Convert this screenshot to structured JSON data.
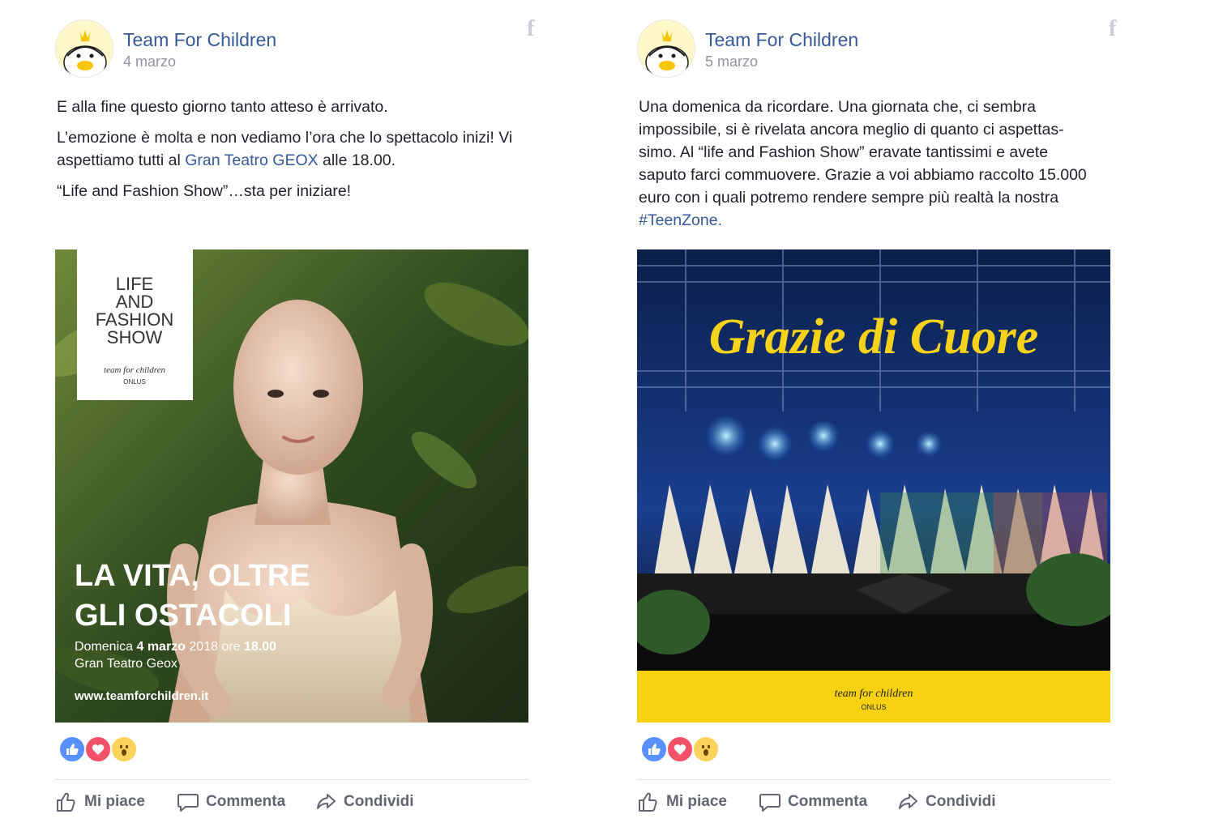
{
  "posts": [
    {
      "author": "Team For Children",
      "date": "4 marzo",
      "paragraphs": [
        "E alla fine questo giorno tanto atteso è arrivato.",
        "L’emozione è molta e non vediamo l’ora che lo spettacolo inizi! Vi aspettiamo tutti al ",
        "“Life and Fashion Show”…sta per iniziare!"
      ],
      "link_text": "Gran Teatro GEOX",
      "link_after": " alle 18.00.",
      "image": {
        "badge_lines": [
          "LIFE",
          "AND",
          "FASHION",
          "SHOW"
        ],
        "badge_logo": "team for children",
        "badge_logo_sub": "ONLUS",
        "headline_1": "LA VITA, OLTRE",
        "headline_2": "GLI OSTACOLI",
        "event_prefix": "Domenica ",
        "event_bold": "4 marzo",
        "event_mid": " 2018 ore ",
        "event_time": "18.00",
        "venue": "Gran Teatro Geox",
        "website": "www.teamforchildren.it"
      },
      "actions": {
        "like": "Mi piace",
        "comment": "Commenta",
        "share": "Condividi"
      }
    },
    {
      "author": "Team For Children",
      "date": "5 marzo",
      "body": "Una domenica da ricordare. Una giornata che, ci sembra impossibile, si è rivelata ancora meglio di quanto ci aspettas-simo. Al “life and Fashion Show” eravate tantissimi e avete saputo farci commuovere. Grazie a voi abbiamo raccolto 15.000 euro con i quali potremo rendere sempre più realtà la nostra ",
      "hashtag": "#TeenZone.",
      "image": {
        "headline": "Grazie di Cuore",
        "logo": "team for children",
        "logo_sub": "ONLUS"
      },
      "actions": {
        "like": "Mi piace",
        "comment": "Commenta",
        "share": "Condividi"
      }
    }
  ],
  "colors": {
    "link": "#365899",
    "meta": "#90949c",
    "action": "#606770",
    "like": "#5890ff",
    "love": "#f25268",
    "wow": "#fcd35a",
    "banner_yellow": "#f8d210"
  },
  "icons": [
    "facebook-icon",
    "like-icon",
    "comment-icon",
    "share-icon",
    "like-reaction-icon",
    "love-reaction-icon",
    "wow-reaction-icon"
  ]
}
